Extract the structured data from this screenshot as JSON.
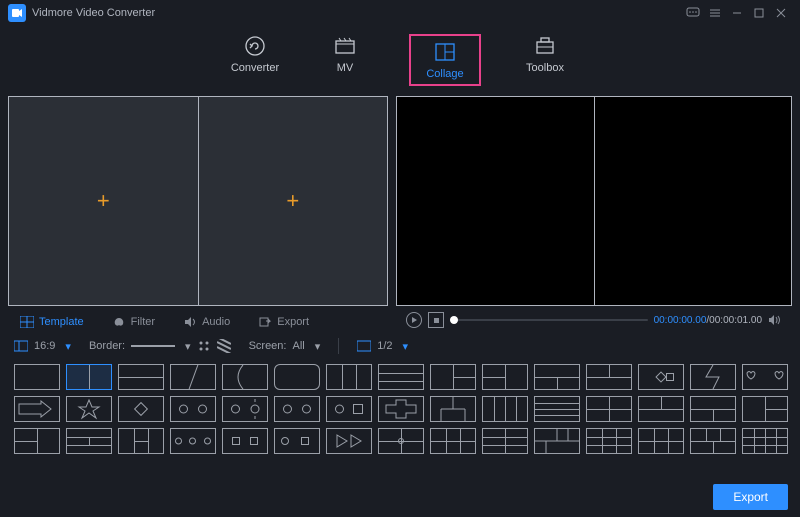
{
  "app": {
    "title": "Vidmore Video Converter"
  },
  "nav": {
    "converter": "Converter",
    "mv": "MV",
    "collage": "Collage",
    "toolbox": "Toolbox",
    "active": "collage"
  },
  "tabs": {
    "template": "Template",
    "filter": "Filter",
    "audio": "Audio",
    "export": "Export",
    "active": "template"
  },
  "playback": {
    "current": "00:00:00.00",
    "total": "00:00:01.00"
  },
  "options": {
    "ratio_label": "16:9",
    "border_label": "Border:",
    "screen_label": "Screen:",
    "screen_value": "All",
    "fraction": "1/2"
  },
  "footer": {
    "export": "Export"
  }
}
